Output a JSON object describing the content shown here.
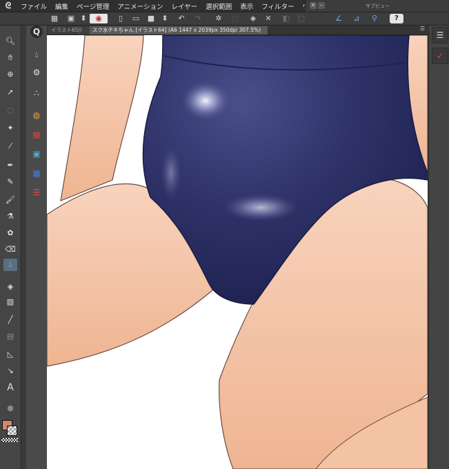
{
  "menubar": {
    "items": [
      "ファイル",
      "編集",
      "ページ管理",
      "アニメーション",
      "レイヤー",
      "選択範囲",
      "表示",
      "フィルター",
      "ウィンド"
    ]
  },
  "subview": {
    "title": "サブビュー"
  },
  "tabs": [
    {
      "label": "イラスト65(I"
    },
    {
      "label": "スク水チキちゃん [イラスト64] (A6 1447 x 2039px 350dpi 307.5%)"
    }
  ],
  "colors": {
    "main_color": "#d4876b",
    "swimsuit": "#2e3268",
    "skin": "#f3c4a6",
    "active_tool": "#5a6e82"
  },
  "icons": {
    "toolbar": [
      "logo",
      "grid",
      "new",
      "open",
      "save",
      "undo",
      "redo",
      "brush-settings",
      "transform",
      "fill",
      "move"
    ],
    "tools": [
      "zoom",
      "hand",
      "operation",
      "move-layer",
      "lasso",
      "selection",
      "eyedropper",
      "pen",
      "pencil",
      "brush",
      "airbrush",
      "decoration",
      "eraser",
      "blend",
      "fill",
      "gradient",
      "figure",
      "frame",
      "ruler",
      "text",
      "balloon"
    ]
  }
}
